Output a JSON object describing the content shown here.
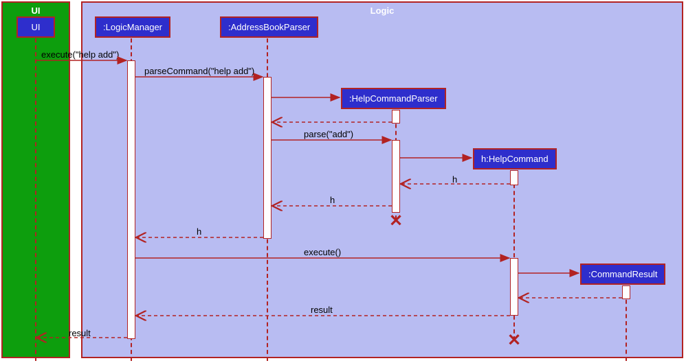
{
  "containers": {
    "ui": "UI",
    "logic": "Logic"
  },
  "participants": {
    "ui": "UI",
    "logicManager": ":LogicManager",
    "addressBookParser": ":AddressBookParser",
    "helpCommandParser": ":HelpCommandParser",
    "helpCommand": "h:HelpCommand",
    "commandResult": ":CommandResult"
  },
  "messages": {
    "execute_help_add": "execute(\"help add\")",
    "parseCommand": "parseCommand(\"help add\")",
    "parse_add": "parse(\"add\")",
    "h1": "h",
    "h2": "h",
    "h3": "h",
    "execute": "execute()",
    "result1": "result",
    "result2": "result"
  },
  "chart_data": {
    "type": "sequence-diagram",
    "frames": [
      {
        "name": "UI",
        "participants": [
          "UI"
        ]
      },
      {
        "name": "Logic",
        "participants": [
          ":LogicManager",
          ":AddressBookParser",
          ":HelpCommandParser",
          "h:HelpCommand",
          ":CommandResult"
        ]
      }
    ],
    "participants": [
      "UI",
      ":LogicManager",
      ":AddressBookParser",
      ":HelpCommandParser",
      "h:HelpCommand",
      ":CommandResult"
    ],
    "participant_created": {
      ":HelpCommandParser": "by :AddressBookParser",
      "h:HelpCommand": "by :HelpCommandParser",
      ":CommandResult": "by h:HelpCommand"
    },
    "participant_destroyed": [
      ":HelpCommandParser",
      "h:HelpCommand"
    ],
    "messages": [
      {
        "from": "UI",
        "to": ":LogicManager",
        "label": "execute(\"help add\")",
        "type": "call"
      },
      {
        "from": ":LogicManager",
        "to": ":AddressBookParser",
        "label": "parseCommand(\"help add\")",
        "type": "call"
      },
      {
        "from": ":AddressBookParser",
        "to": ":HelpCommandParser",
        "label": "",
        "type": "create"
      },
      {
        "from": ":HelpCommandParser",
        "to": ":AddressBookParser",
        "label": "",
        "type": "return"
      },
      {
        "from": ":AddressBookParser",
        "to": ":HelpCommandParser",
        "label": "parse(\"add\")",
        "type": "call"
      },
      {
        "from": ":HelpCommandParser",
        "to": "h:HelpCommand",
        "label": "",
        "type": "create"
      },
      {
        "from": "h:HelpCommand",
        "to": ":HelpCommandParser",
        "label": "h",
        "type": "return"
      },
      {
        "from": ":HelpCommandParser",
        "to": ":AddressBookParser",
        "label": "h",
        "type": "return"
      },
      {
        "from": ":AddressBookParser",
        "to": ":LogicManager",
        "label": "h",
        "type": "return"
      },
      {
        "from": ":LogicManager",
        "to": "h:HelpCommand",
        "label": "execute()",
        "type": "call"
      },
      {
        "from": "h:HelpCommand",
        "to": ":CommandResult",
        "label": "",
        "type": "create"
      },
      {
        "from": ":CommandResult",
        "to": "h:HelpCommand",
        "label": "",
        "type": "return"
      },
      {
        "from": "h:HelpCommand",
        "to": ":LogicManager",
        "label": "result",
        "type": "return"
      },
      {
        "from": ":LogicManager",
        "to": "UI",
        "label": "result",
        "type": "return"
      }
    ]
  }
}
